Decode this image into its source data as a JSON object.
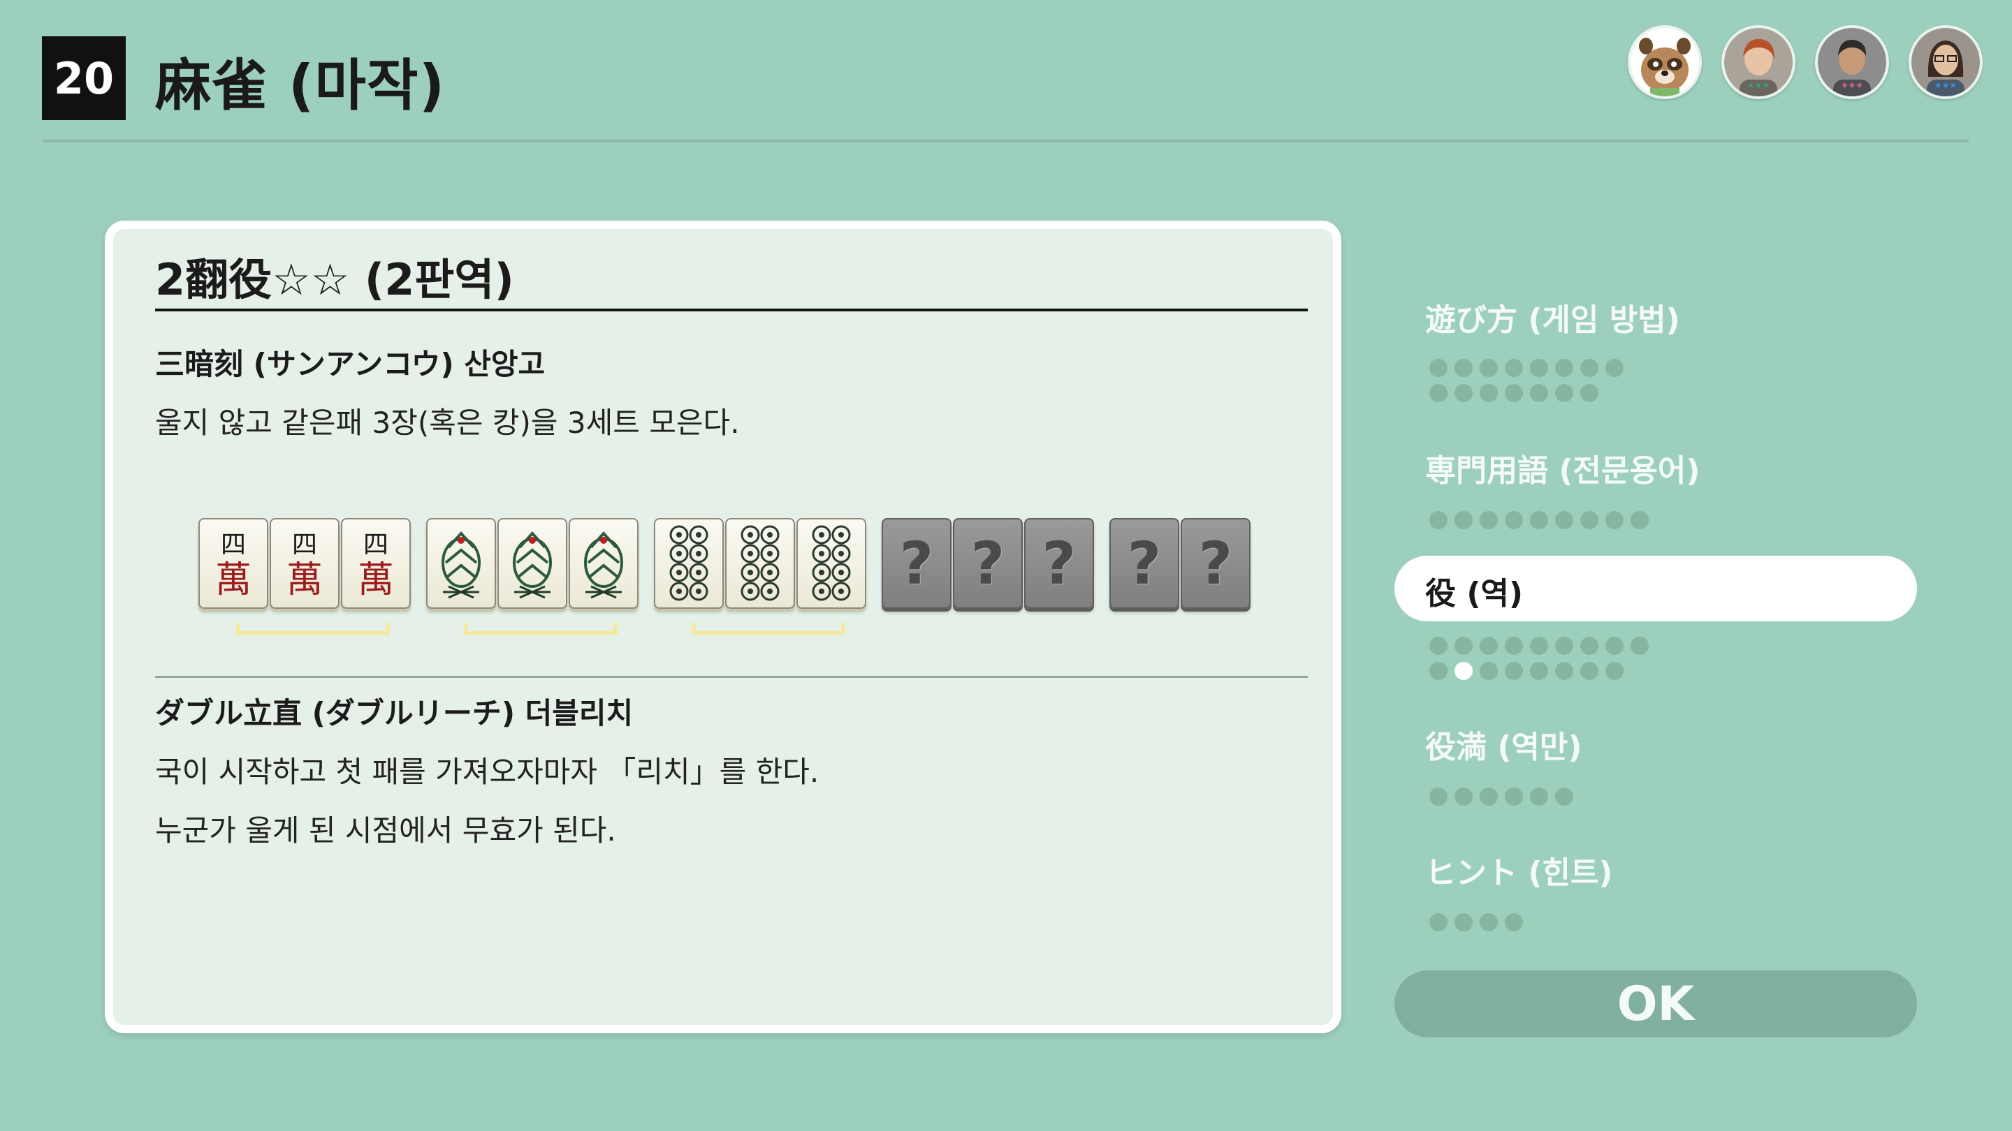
{
  "header": {
    "number": "20",
    "title": "麻雀 (마작)"
  },
  "panel": {
    "title": "2翻役☆☆ (2판역)",
    "yaku": [
      {
        "name": "三暗刻 (サンアンコウ) 산앙고",
        "description": [
          "울지 않고 같은패 3장(혹은 캉)을 3세트 모은다."
        ]
      },
      {
        "name": "ダブル立直 (ダブルリーチ) 더블리치",
        "description": [
          "국이 시작하고 첫 패를 가져오자마자 「리치」를 한다.",
          "누군가 울게 된 시점에서 무효가 된다."
        ]
      }
    ],
    "tiles": {
      "groups": [
        {
          "suit": "characters",
          "glyph_top": "四",
          "glyph_bottom": "萬",
          "count": 3
        },
        {
          "suit": "bamboo",
          "count": 3
        },
        {
          "suit": "circles",
          "count": 3
        },
        {
          "suit": "unknown",
          "count": 3
        },
        {
          "suit": "unknown",
          "count": 2
        }
      ],
      "unknown_symbol": "?"
    }
  },
  "menu": {
    "items": [
      {
        "label": "遊び方 (게임 방법)",
        "pages": 15,
        "current": null
      },
      {
        "label": "専門用語 (전문용어)",
        "pages": 9,
        "current": null
      },
      {
        "label": "役 (역)",
        "pages": 17,
        "current": 11,
        "active": true
      },
      {
        "label": "役満 (역만)",
        "pages": 6,
        "current": null
      },
      {
        "label": "ヒント (힌트)",
        "pages": 4,
        "current": null
      }
    ],
    "ok_label": "OK"
  },
  "players": [
    {
      "name": "raccoon-host",
      "icon": "raccoon-avatar-icon"
    },
    {
      "name": "player-2",
      "icon": "person-avatar-icon"
    },
    {
      "name": "player-3",
      "icon": "person-avatar-icon"
    },
    {
      "name": "player-4",
      "icon": "person-avatar-icon"
    }
  ],
  "colors": {
    "background": "#9dcfbd",
    "panel": "#e5f1e8",
    "bracket": "#f3e9a1",
    "dot_inactive": "#86b5a2",
    "dot_active": "#ffffff"
  }
}
